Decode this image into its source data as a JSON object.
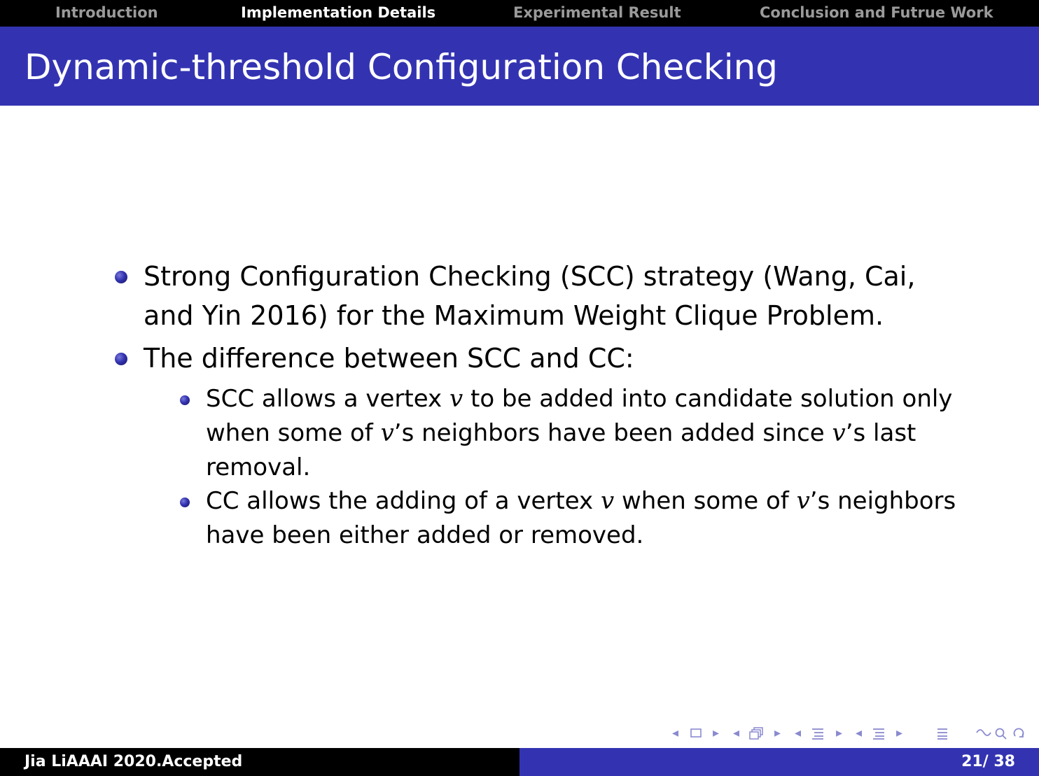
{
  "nav": {
    "items": [
      {
        "label": "Introduction",
        "active": false
      },
      {
        "label": "Implementation Details",
        "active": true
      },
      {
        "label": "Experimental Result",
        "active": false
      },
      {
        "label": "Conclusion and Futrue Work",
        "active": false
      }
    ]
  },
  "slide": {
    "title": "Dynamic-threshold Configuration Checking",
    "bullets": [
      {
        "line1": "Strong Configuration Checking (SCC) strategy (Wang, Cai,",
        "line2": "and Yin 2016) for the Maximum Weight Clique Problem."
      },
      {
        "line1": "The difference between SCC and CC:"
      }
    ],
    "subbullets": [
      {
        "l1a": "SCC allows a vertex ",
        "v1": "v",
        "l1b": " to be added into candidate solution only",
        "l2a": "when some of ",
        "v2": "v",
        "l2b": "’s neighbors have been added since ",
        "v3": "v",
        "l2c": "’s last",
        "l3": "removal."
      },
      {
        "l1a": "CC allows the adding of a vertex ",
        "v1": "v",
        "l1b": " when some of ",
        "v2": "v",
        "l1c": "’s neighbors",
        "l2": "have been either added or removed."
      }
    ]
  },
  "navigation_symbols": [
    "frame-nav-icon",
    "subsection-nav-icon",
    "section-nav-icon",
    "document-nav-icon",
    "search-icon"
  ],
  "footer": {
    "left": "Jia LiAAAI 2020.Accepted",
    "page": "21/ 38"
  },
  "colors": {
    "title_bar": "#3333b2",
    "nav_bar": "#000000",
    "nav_inactive": "#9a9a9a",
    "nav_active": "#ffffff"
  }
}
